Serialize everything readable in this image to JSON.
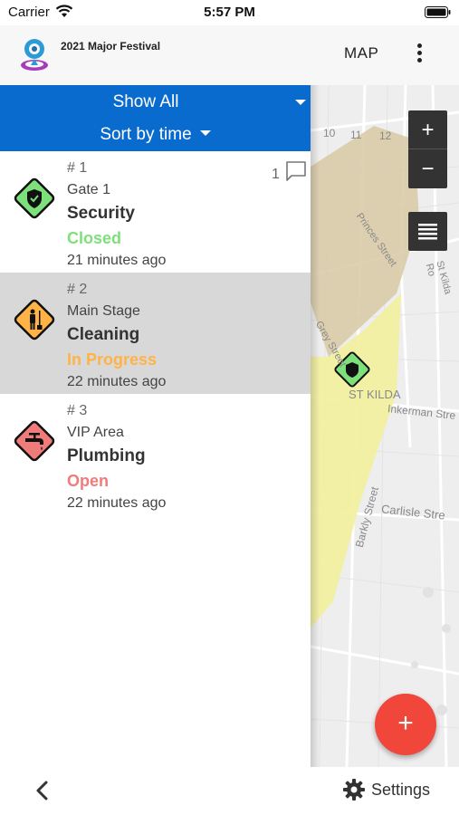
{
  "status_bar": {
    "carrier": "Carrier",
    "time": "5:57 PM"
  },
  "app_bar": {
    "title": "2021 Major Festival",
    "map_label": "MAP"
  },
  "filters": {
    "show_all": "Show All",
    "sort_by": "Sort by time"
  },
  "incidents": [
    {
      "number": "# 1",
      "location": "Gate 1",
      "type": "Security",
      "status": "Closed",
      "status_color": "#7ee07a",
      "time_ago": "21 minutes ago",
      "comment_count": "1",
      "icon": "security-shield-icon",
      "icon_color": "#7ee07a",
      "selected": false
    },
    {
      "number": "# 2",
      "location": "Main Stage",
      "type": "Cleaning",
      "status": "In Progress",
      "status_color": "#ffb347",
      "time_ago": "22 minutes ago",
      "icon": "cleaning-icon",
      "icon_color": "#ffb347",
      "selected": true
    },
    {
      "number": "# 3",
      "location": "VIP Area",
      "type": "Plumbing",
      "status": "Open",
      "status_color": "#f07b7b",
      "time_ago": "22 minutes ago",
      "icon": "plumbing-faucet-icon",
      "icon_color": "#f07b7b",
      "selected": false
    }
  ],
  "map": {
    "zoom_in": "+",
    "zoom_out": "−",
    "labels": {
      "n10": "10",
      "n11": "11",
      "n12": "12",
      "st_kilda": "ST KILDA",
      "inkerman": "Inkerman Stre",
      "carlisle": "Carlisle Stre",
      "barkly": "Barkly Street",
      "grey": "Grey Street",
      "st_kilda_rd": "St Kilda Ro",
      "princes": "Princes Street"
    }
  },
  "fab": {
    "label": "+"
  },
  "bottom_bar": {
    "settings_label": "Settings"
  }
}
